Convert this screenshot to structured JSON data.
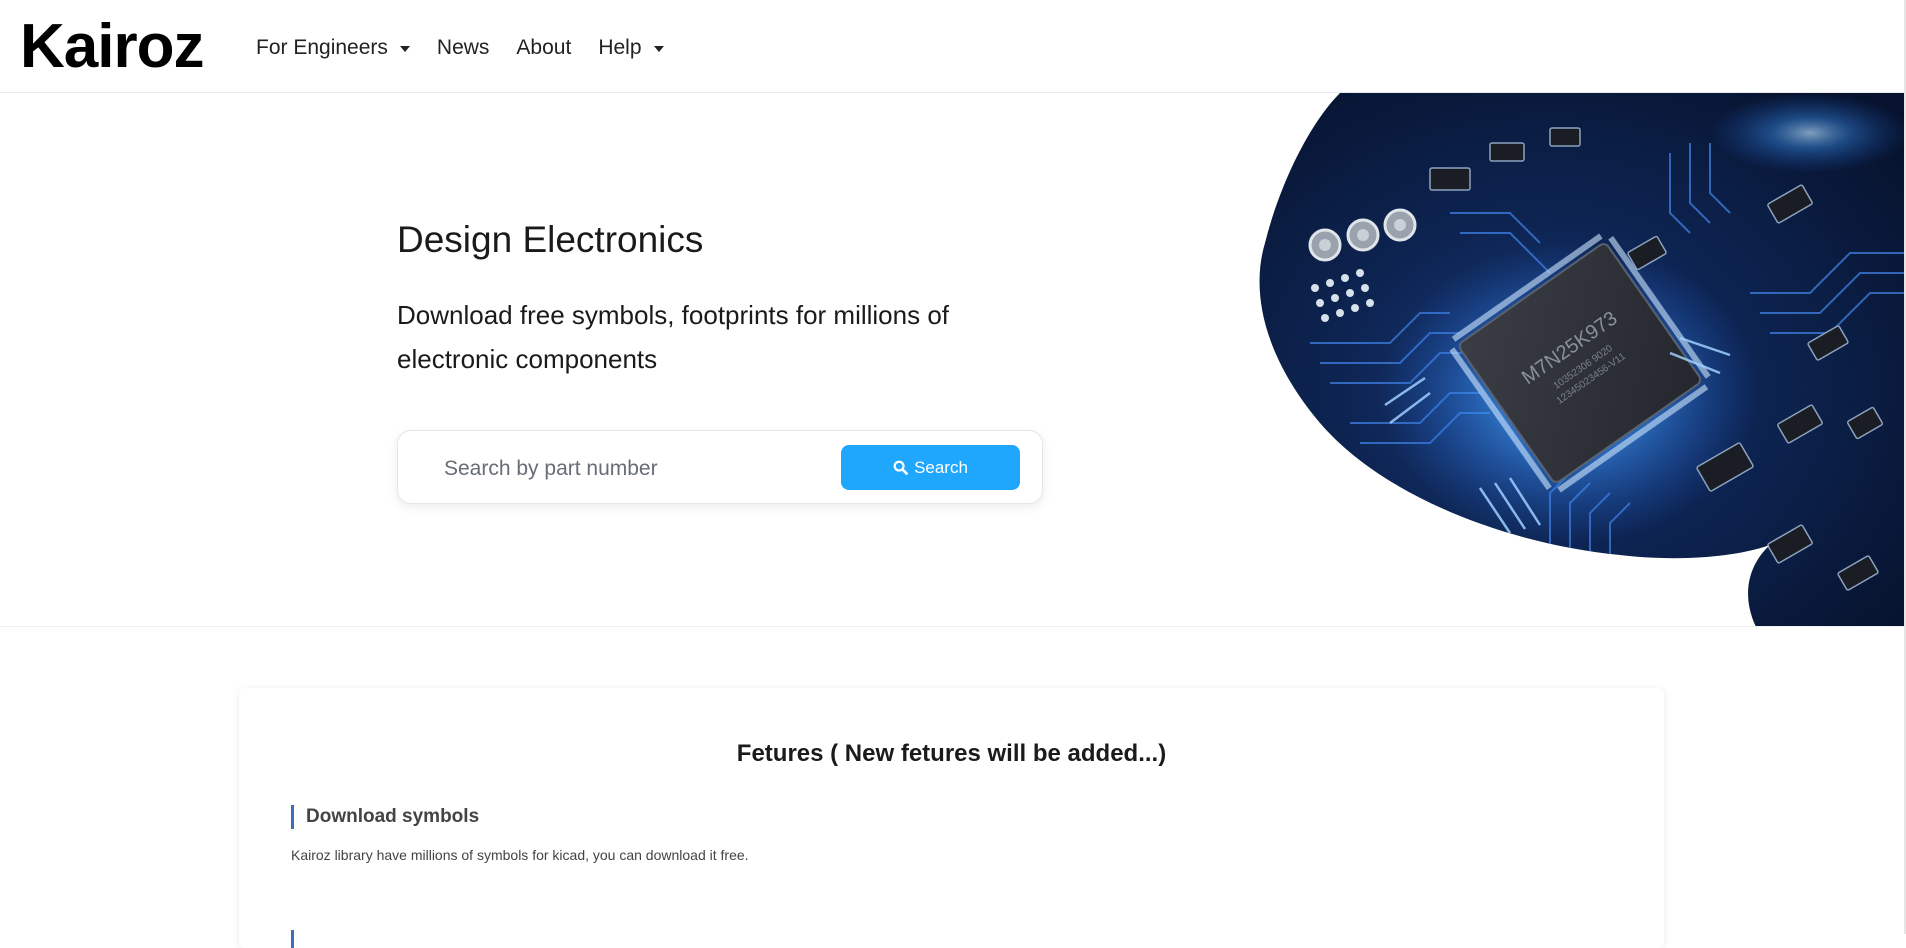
{
  "brand": {
    "logo": "Kairoz"
  },
  "nav": {
    "items": [
      {
        "label": "For Engineers",
        "has_dropdown": true
      },
      {
        "label": "News",
        "has_dropdown": false
      },
      {
        "label": "About",
        "has_dropdown": false
      },
      {
        "label": "Help",
        "has_dropdown": true
      }
    ]
  },
  "hero": {
    "title": "Design Electronics",
    "subtitle": "Download free symbols, footprints for millions of electronic components",
    "search": {
      "placeholder": "Search by part number",
      "value": "",
      "button_label": "Search",
      "button_icon": "search-icon"
    },
    "image": {
      "chip_marking": "M7N25K973",
      "chip_line2": "10352306 9020",
      "chip_line3": "12345023456-V11"
    }
  },
  "features": {
    "title": "Fetures ( New fetures will be added...)",
    "items": [
      {
        "heading": "Download symbols",
        "text": "Kairoz library have millions of symbols for kicad, you can download it free."
      }
    ]
  },
  "colors": {
    "accent": "#1ea7fd",
    "feature_bar": "#3b6fb6",
    "pcb_dark": "#0a1b3a",
    "pcb_glow": "#4aa8ff"
  }
}
